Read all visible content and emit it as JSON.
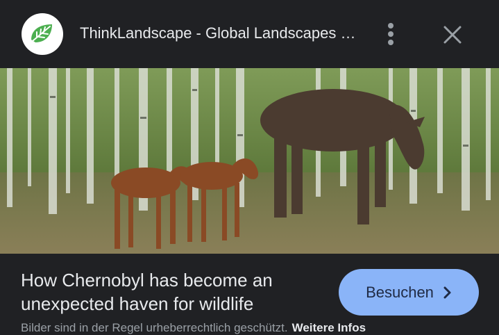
{
  "header": {
    "logo_icon": "thinklandscape-leaf-logo",
    "title": "ThinkLandscape - Global Landscapes Forum",
    "more_icon": "more-vert-icon",
    "close_icon": "close-icon"
  },
  "image": {
    "lens_icon": "google-lens-icon"
  },
  "caption": {
    "line1": "How Chernobyl has become an",
    "line2": "unexpected haven for wildlife"
  },
  "visit_button": {
    "label": "Besuchen",
    "icon": "chevron-right-icon"
  },
  "footer": {
    "copyright": "Bilder sind in der Regel urheberrechtlich geschützt.",
    "more_info": "Weitere Infos"
  },
  "colors": {
    "background": "#202124",
    "accent": "#8ab4f8",
    "logo_green": "#4caf50"
  }
}
